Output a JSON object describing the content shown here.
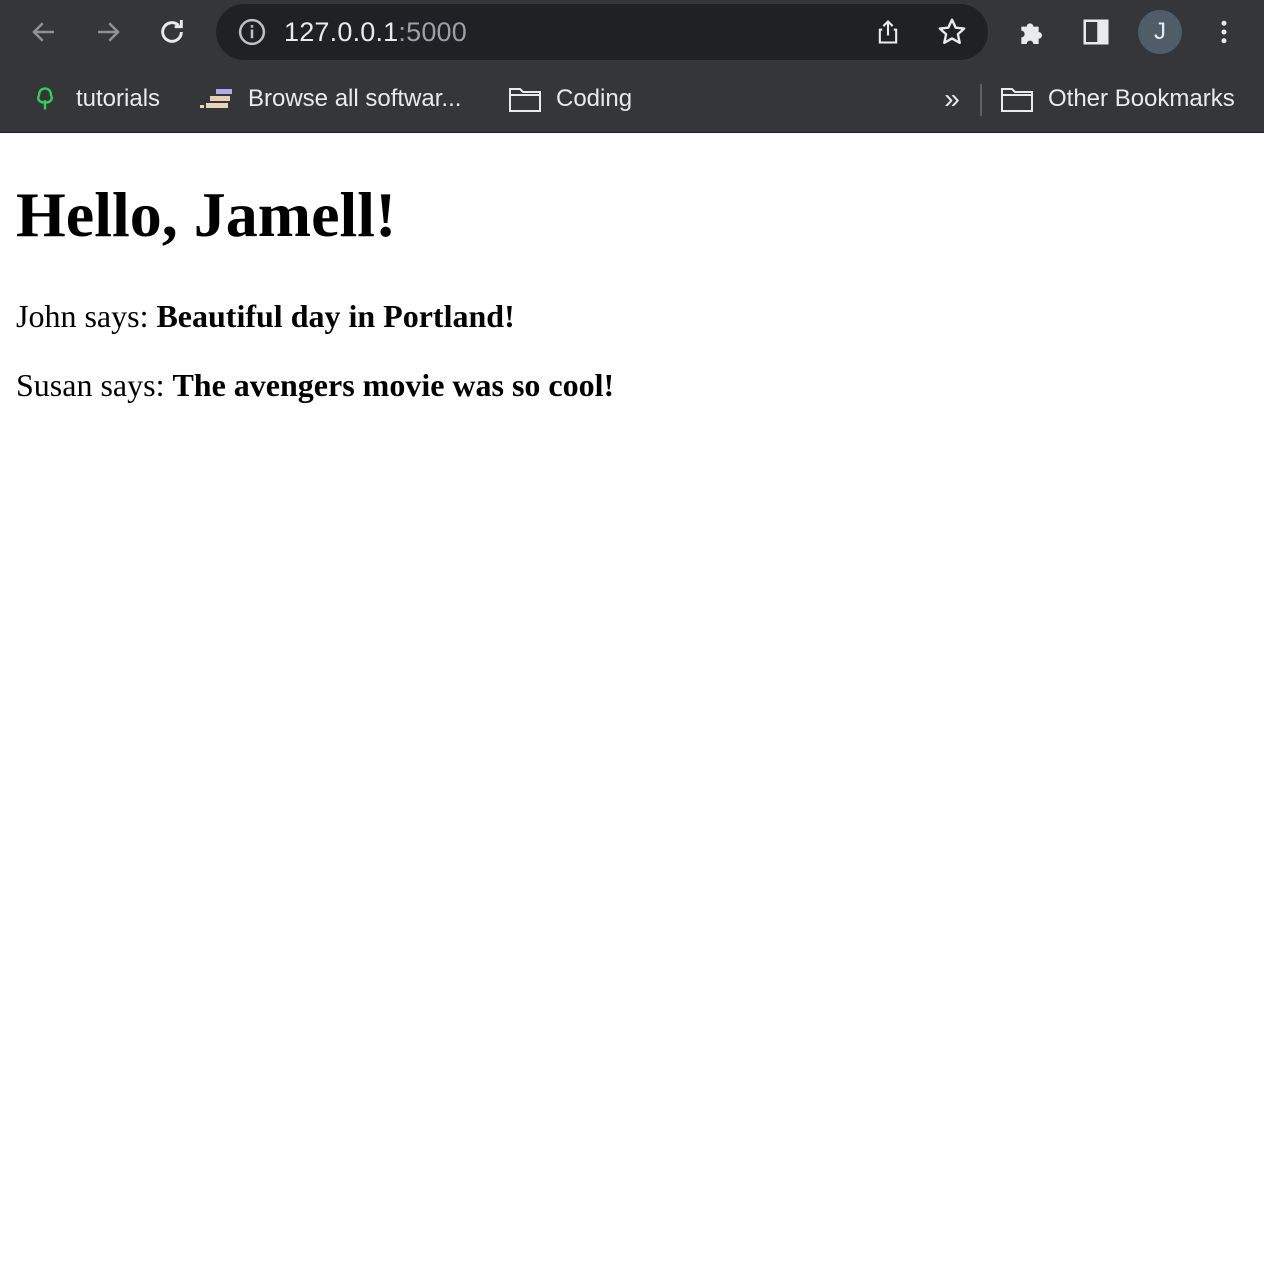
{
  "browser": {
    "url_host": "127.0.0.1",
    "url_port": ":5000",
    "profile_initial": "J",
    "bookmarks": [
      {
        "label": "tutorials",
        "icon": "tree-icon"
      },
      {
        "label": "Browse all softwar...",
        "icon": "books-icon"
      },
      {
        "label": "Coding",
        "icon": "folder-icon"
      }
    ],
    "overflow_label": "»",
    "other_bookmarks": "Other Bookmarks"
  },
  "page": {
    "heading": "Hello, Jamell!",
    "posts": [
      {
        "author_prefix": "John says: ",
        "body": "Beautiful day in Portland!"
      },
      {
        "author_prefix": "Susan says: ",
        "body": "The avengers movie was so cool!"
      }
    ]
  }
}
